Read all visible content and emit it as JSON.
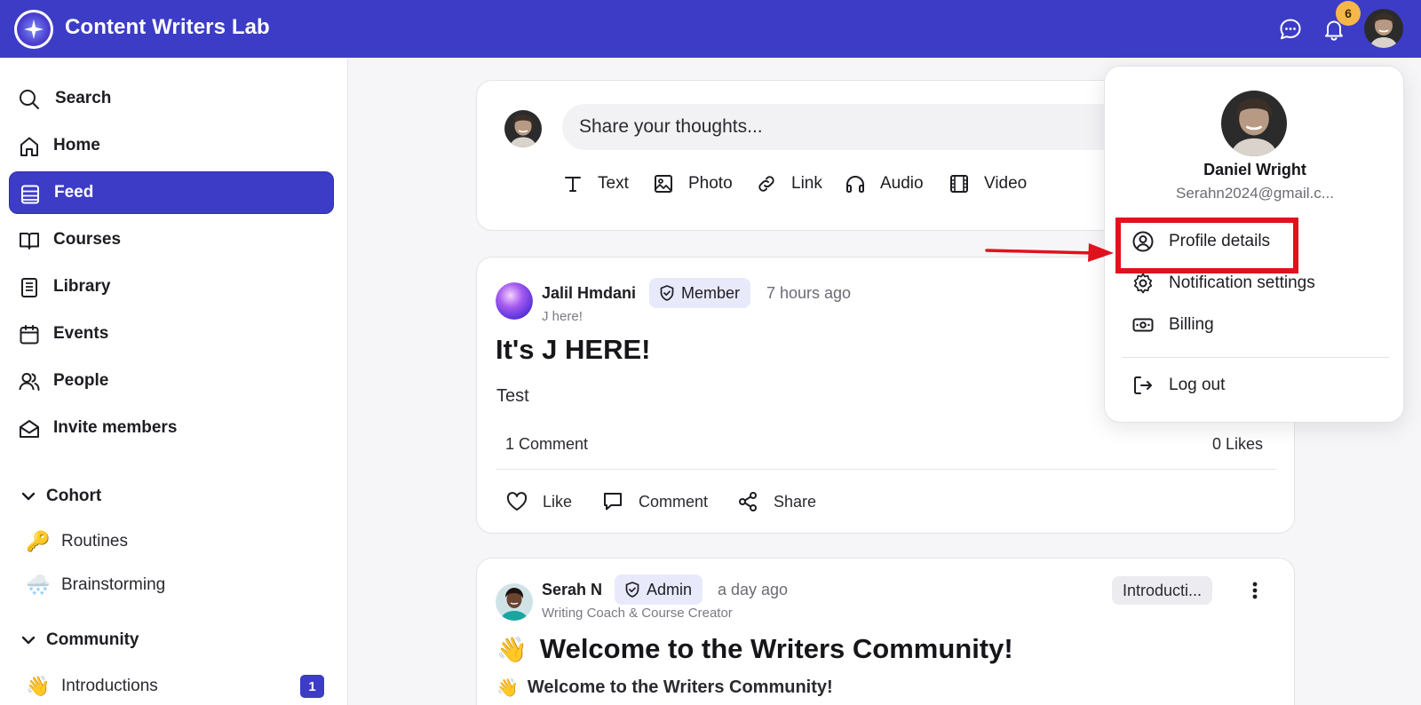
{
  "app": {
    "title": "Content Writers Lab",
    "notification_count": "6"
  },
  "sidebar": {
    "nav": [
      {
        "label": "Search",
        "icon": "search-icon"
      },
      {
        "label": "Home",
        "icon": "home-icon"
      },
      {
        "label": "Feed",
        "icon": "feed-icon",
        "active": true
      },
      {
        "label": "Courses",
        "icon": "book-open-icon"
      },
      {
        "label": "Library",
        "icon": "library-icon"
      },
      {
        "label": "Events",
        "icon": "calendar-icon"
      },
      {
        "label": "People",
        "icon": "people-icon"
      },
      {
        "label": "Invite members",
        "icon": "mail-open-icon"
      }
    ],
    "sections": [
      {
        "label": "Cohort",
        "channels": [
          {
            "emoji": "🔑",
            "label": "Routines"
          },
          {
            "emoji": "🌨️",
            "label": "Brainstorming"
          }
        ]
      },
      {
        "label": "Community",
        "channels": [
          {
            "emoji": "👋",
            "label": "Introductions",
            "count": "1"
          }
        ]
      }
    ]
  },
  "composer": {
    "placeholder": "Share your thoughts...",
    "types": [
      "Text",
      "Photo",
      "Link",
      "Audio",
      "Video"
    ]
  },
  "posts": [
    {
      "author": "Jalil Hmdani",
      "role": "Member",
      "time": "7 hours ago",
      "subline": "J here!",
      "title": "It's J HERE!",
      "body": "Test",
      "comments": "1 Comment",
      "likes": "0 Likes",
      "actions": [
        "Like",
        "Comment",
        "Share"
      ]
    },
    {
      "author": "Serah N",
      "role": "Admin",
      "time": "a day ago",
      "subline": "Writing Coach & Course Creator",
      "tag": "Introducti...",
      "title_emoji": "👋",
      "title": "Welcome to the Writers Community!",
      "body_emoji": "👋",
      "body": "Welcome to the Writers Community!"
    }
  ],
  "profile_menu": {
    "name": "Daniel Wright",
    "email": "Serahn2024@gmail.c...",
    "items": [
      "Profile details",
      "Notification settings",
      "Billing"
    ],
    "logout": "Log out"
  },
  "colors": {
    "brand": "#3d3cc6",
    "highlight": "#e0121d",
    "badge": "#f6b74a"
  }
}
